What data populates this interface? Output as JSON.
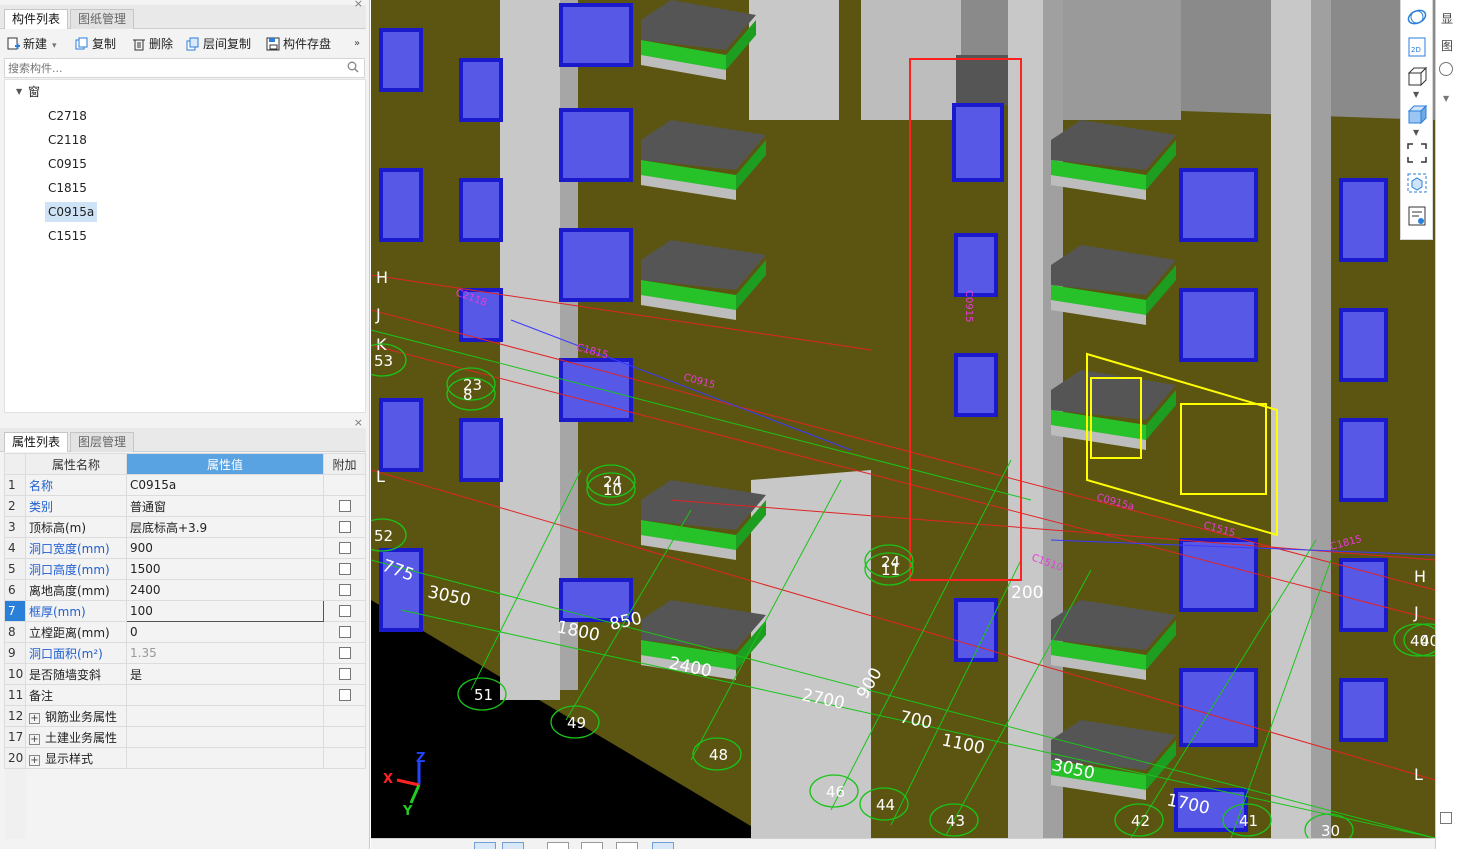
{
  "left_top": {
    "tabs": [
      "构件列表",
      "图纸管理"
    ],
    "close": "×",
    "toolbar": [
      {
        "label": "新建",
        "icon": "new-icon"
      },
      {
        "label": "复制",
        "icon": "copy-icon"
      },
      {
        "label": "删除",
        "icon": "delete-icon"
      },
      {
        "label": "层间复制",
        "icon": "floor-copy-icon"
      },
      {
        "label": "构件存盘",
        "icon": "save-component-icon"
      }
    ],
    "more": "»",
    "search_placeholder": "搜索构件...",
    "tree": {
      "root": "窗",
      "items": [
        "C2718",
        "C2118",
        "C0915",
        "C1815",
        "C0915a",
        "C1515"
      ],
      "selected": "C0915a"
    }
  },
  "left_bottom": {
    "tabs": [
      "属性列表",
      "图层管理"
    ],
    "close": "×",
    "columns": [
      "属性名称",
      "属性值",
      "附加"
    ],
    "rows": [
      {
        "no": "1",
        "name": "名称",
        "value": "C0915a",
        "blue": true,
        "check": false
      },
      {
        "no": "2",
        "name": "类别",
        "value": "普通窗",
        "blue": true,
        "check": true
      },
      {
        "no": "3",
        "name": "顶标高(m)",
        "value": "层底标高+3.9",
        "blue": false,
        "check": true
      },
      {
        "no": "4",
        "name": "洞口宽度(mm)",
        "value": "900",
        "blue": true,
        "check": true
      },
      {
        "no": "5",
        "name": "洞口高度(mm)",
        "value": "1500",
        "blue": true,
        "check": true
      },
      {
        "no": "6",
        "name": "离地高度(mm)",
        "value": "2400",
        "blue": false,
        "check": true
      },
      {
        "no": "7",
        "name": "框厚(mm)",
        "value": "100",
        "blue": true,
        "check": true
      },
      {
        "no": "8",
        "name": "立樘距离(mm)",
        "value": "0",
        "blue": false,
        "check": true
      },
      {
        "no": "9",
        "name": "洞口面积(m²)",
        "value": "1.35",
        "blue": true,
        "check": true
      },
      {
        "no": "10",
        "name": "是否随墙变斜",
        "value": "是",
        "blue": false,
        "check": true
      },
      {
        "no": "11",
        "name": "备注",
        "value": "",
        "blue": false,
        "check": true
      },
      {
        "no": "12",
        "name": "钢筋业务属性",
        "value": "",
        "group": true
      },
      {
        "no": "17",
        "name": "土建业务属性",
        "value": "",
        "group": true
      },
      {
        "no": "20",
        "name": "显示样式",
        "value": "",
        "group": true
      }
    ],
    "selected_row": "7"
  },
  "viewport": {
    "axis_letters": [
      "H",
      "J",
      "K",
      "L"
    ],
    "dims": [
      "3050",
      "1800",
      "2400",
      "2700",
      "700",
      "1100",
      "3050",
      "1700",
      "850",
      "775",
      "900",
      "200"
    ],
    "circle_labels": [
      "23",
      "8",
      "24",
      "10",
      "24",
      "11",
      "51",
      "49",
      "48",
      "46",
      "44",
      "43",
      "42",
      "41",
      "40",
      "53",
      "52",
      "40",
      "30"
    ],
    "window_tags": [
      "C2118",
      "C1815",
      "C0915",
      "C0915",
      "C1515",
      "C0915a",
      "C1815",
      "C1510"
    ],
    "axis_gizmo": {
      "x": "X",
      "y": "Y",
      "z": "Z"
    }
  },
  "right_toolbar": {
    "icons": [
      "orbit-icon",
      "2d-view-icon",
      "3d-box-icon",
      "3d-solid-icon",
      "fullscreen-icon",
      "component-view-icon",
      "display-settings-icon"
    ],
    "label_2d": "2D"
  },
  "far_right": {
    "labels": [
      "显",
      "图"
    ]
  },
  "colors": {
    "wall_olive": "#5c5512",
    "column_grey": "#c8c8c8",
    "balcony_green": "#27c12a",
    "window_blue": "#5758e6",
    "axis_red": "#e02424",
    "axis_green": "#19c419",
    "highlight_yellow": "#ffff00",
    "selection_red": "#ff2020"
  }
}
